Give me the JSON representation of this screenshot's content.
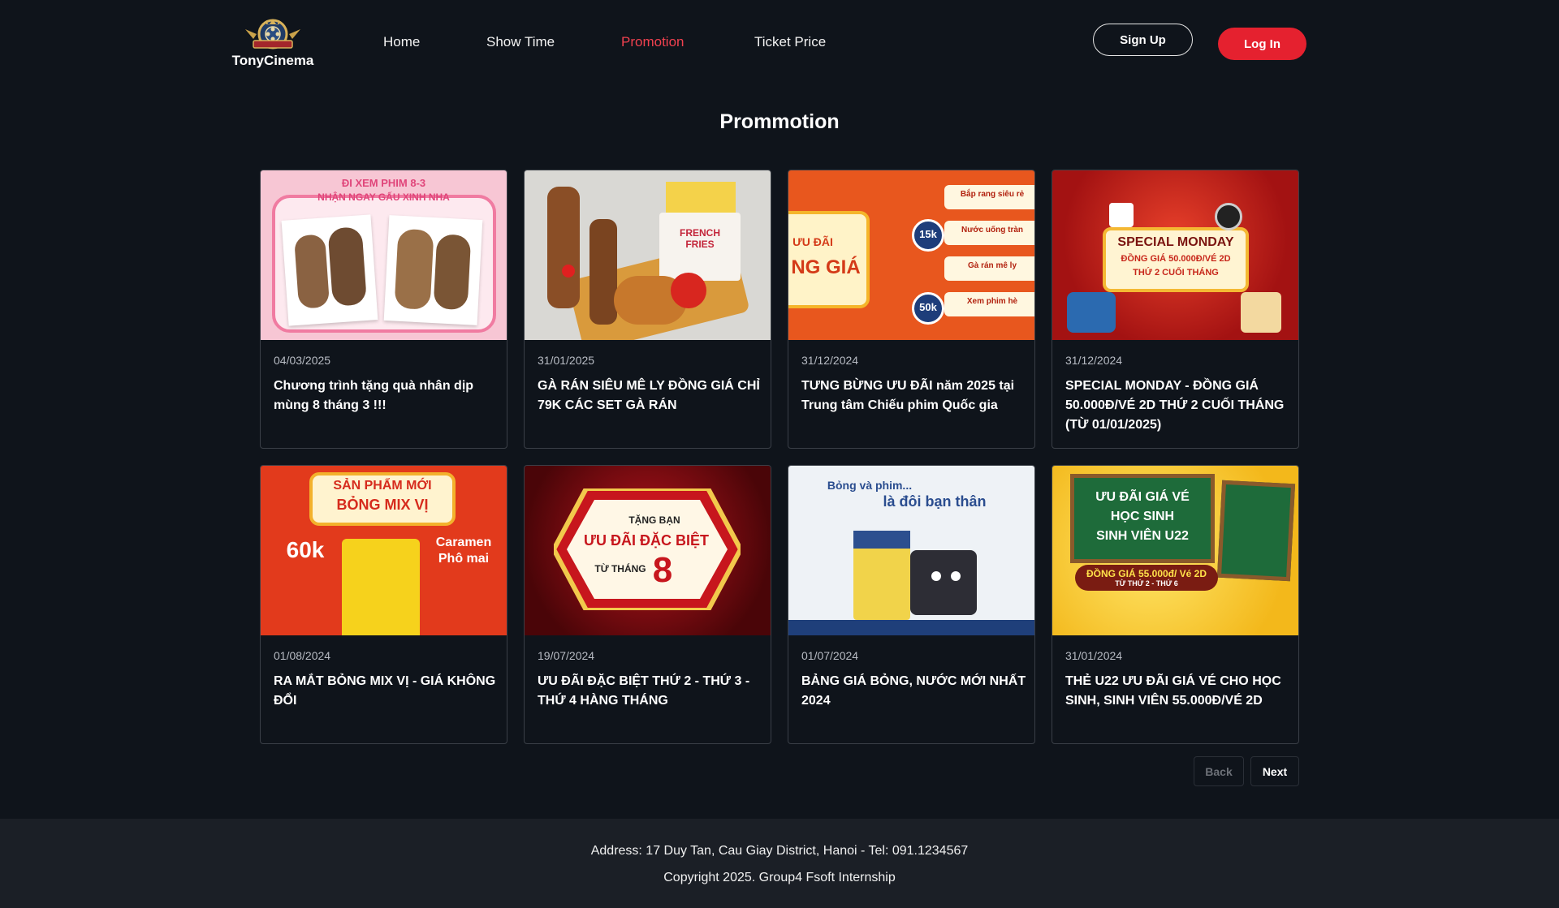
{
  "brand": {
    "name": "TonyCinema"
  },
  "nav": {
    "items": [
      {
        "label": "Home",
        "active": false
      },
      {
        "label": "Show Time",
        "active": false
      },
      {
        "label": "Promotion",
        "active": true
      },
      {
        "label": "Ticket Price",
        "active": false
      }
    ]
  },
  "auth": {
    "signup_label": "Sign Up",
    "login_label": "Log In"
  },
  "page": {
    "title": "Prommotion"
  },
  "promotions": [
    {
      "date": "04/03/2025",
      "title": "Chương trình tặng quà nhân dịp\nmùng 8 tháng 3 !!!",
      "image_text": [
        "ĐI XEM PHIM 8-3",
        "NHẬN NGAY GẤU XINH NHA"
      ]
    },
    {
      "date": "31/01/2025",
      "title": "GÀ RÁN SIÊU MÊ LY ĐỒNG GIÁ CHỈ 79K CÁC SET GÀ RÁN",
      "image_text": [
        "FRENCH FRIES"
      ]
    },
    {
      "date": "31/12/2024",
      "title": "TƯNG BỪNG ƯU ĐÃI năm 2025 tại Trung tâm Chiếu phim Quốc gia",
      "image_text": [
        "ƯU ĐÃI",
        "NG GIÁ",
        "15k",
        "50k",
        "Bắp rang siêu rẻ",
        "Nước uống tràn",
        "Gà rán mê ly",
        "Xem phim hè"
      ]
    },
    {
      "date": "31/12/2024",
      "title": "SPECIAL MONDAY - ĐỒNG GIÁ 50.000Đ/VÉ 2D THỨ 2 CUỐI THÁNG (TỪ 01/01/2025)",
      "image_text": [
        "SPECIAL MONDAY",
        "ĐỒNG GIÁ 50.000Đ/VÉ 2D",
        "THỨ 2 CUỐI THÁNG"
      ]
    },
    {
      "date": "01/08/2024",
      "title": "RA MẮT BỎNG MIX VỊ - GIÁ KHÔNG ĐỔI",
      "image_text": [
        "SẢN PHẨM MỚI",
        "BỎNG MIX VỊ",
        "60k",
        "Caramen",
        "Phô mai"
      ]
    },
    {
      "date": "19/07/2024",
      "title": "ƯU ĐÃI ĐẶC BIỆT THỨ 2 - THỨ 3 - THỨ 4 HÀNG THÁNG",
      "image_text": [
        "TẶNG BẠN",
        "ƯU ĐÃI ĐẶC BIỆT",
        "TỪ THÁNG",
        "8"
      ]
    },
    {
      "date": "01/07/2024",
      "title": "BẢNG GIÁ BỎNG, NƯỚC MỚI NHẤT 2024",
      "image_text": [
        "Bỏng và phim...",
        "là đôi bạn thân"
      ]
    },
    {
      "date": "31/01/2024",
      "title": "THẺ U22 ƯU ĐÃI GIÁ VÉ CHO HỌC SINH, SINH VIÊN 55.000Đ/VÉ 2D",
      "image_text": [
        "ƯU ĐÃI GIÁ VÉ",
        "HỌC SINH",
        "SINH VIÊN U22",
        "ĐỒNG GIÁ 55.000đ/ Vé 2D",
        "TỪ THỨ 2 - THỨ 6"
      ]
    }
  ],
  "pagination": {
    "back_label": "Back",
    "next_label": "Next"
  },
  "footer": {
    "address": "Address: 17 Duy Tan, Cau Giay District, Hanoi - Tel: 091.1234567",
    "copyright": "Copyright 2025. Group4 Fsoft Internship"
  },
  "colors": {
    "background": "#0f141b",
    "accent": "#e5212f",
    "active_nav": "#f0414f",
    "footer": "#1b1f26"
  }
}
